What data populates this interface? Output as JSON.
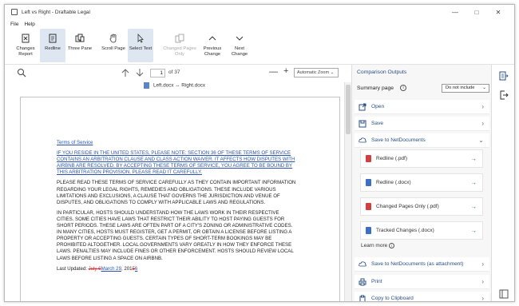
{
  "window": {
    "title": "Left vs Right - Draftable Legal",
    "controls": {
      "minimize": "—",
      "maximize": "□",
      "close": "✕"
    }
  },
  "menu": [
    "File",
    "Help"
  ],
  "ribbon": [
    {
      "label": "Changes Report",
      "icon": "changes-report-icon"
    },
    {
      "label": "Redline",
      "icon": "redline-icon",
      "active": true
    },
    {
      "label": "Three Pane",
      "icon": "three-pane-icon"
    },
    {
      "label": "Scroll Page",
      "icon": "scroll-page-icon"
    },
    {
      "label": "Select Text",
      "icon": "select-text-icon",
      "active": true
    },
    {
      "label": "Changed Pages Only",
      "icon": "changed-pages-icon",
      "disabled": true
    },
    {
      "label": "Previous Change",
      "icon": "chevron-up-icon"
    },
    {
      "label": "Next Change",
      "icon": "chevron-down-icon"
    }
  ],
  "toolbar": {
    "page_current": "1",
    "page_of": "of 37",
    "zoom": "Automatic Zoom",
    "zoom_minus": "—",
    "zoom_plus": "+"
  },
  "document": {
    "filename": "Left.docx ↔ Right.docx",
    "heading": "Terms of Service",
    "para1": "IF YOU RESIDE IN THE UNITED STATES, PLEASE NOTE: SECTION 36 OF THESE TERMS OF SERVICE CONTAINS AN ARBITRATION CLAUSE AND CLASS ACTION WAIVER. IT AFFECTS HOW DISPUTES WITH AIRBNB ARE RESOLVED. BY ACCEPTING THESE TERMS OF SERVICE, YOU AGREE TO BE BOUND BY THIS ARBITRATION PROVISION. PLEASE READ IT CAREFULLY.",
    "para2": "PLEASE READ THESE TERMS OF SERVICE CAREFULLY AS THEY CONTAIN IMPORTANT INFORMATION REGARDING YOUR LEGAL RIGHTS, REMEDIES AND OBLIGATIONS. THESE INCLUDE VARIOUS LIMITATIONS AND EXCLUSIONS, A CLAUSE THAT GOVERNS THE JURISDICTION AND VENUE OF DISPUTES, AND OBLIGATIONS TO COMPLY WITH APPLICABLE LAWS AND REGULATIONS.",
    "para3": "IN PARTICULAR, HOSTS SHOULD UNDERSTAND HOW THE LAWS WORK IN THEIR RESPECTIVE CITIES. SOME CITIES HAVE LAWS THAT RESTRICT THEIR ABILITY TO HOST PAYING GUESTS FOR SHORT PERIODS. THESE LAWS ARE OFTEN PART OF A CITY'S ZONING OR ADMINISTRATIVE CODES. IN MANY CITIES, HOSTS MUST REGISTER, GET A PERMIT, OR OBTAIN A LICENSE BEFORE LISTING A PROPERTY OR ACCEPTING GUESTS. CERTAIN TYPES OF SHORT-TERM BOOKINGS MAY BE PROHIBITED ALTOGETHER. LOCAL GOVERNMENTS VARY GREATLY IN HOW THEY ENFORCE THESE LAWS. PENALTIES MAY INCLUDE FINES OR OTHER ENFORCEMENT. HOSTS SHOULD REVIEW LOCAL LAWS BEFORE LISTING A SPACE ON AIRBNB.",
    "updated_label": "Last Updated: ",
    "updated_del1": "July 6",
    "updated_ins1": "March 29",
    "updated_mid": ", 201",
    "updated_del2": "5",
    "updated_ins2": "6"
  },
  "panel": {
    "title": "Comparison Outputs",
    "summary_label": "Summary page",
    "summary_select": "Do not include",
    "open": "Open",
    "save": "Save",
    "save_nd": "Save to NetDocuments",
    "sub_items": [
      "Redline (.pdf)",
      "Redline (.docx)",
      "Changed Pages Only (.pdf)",
      "Tracked Changes (.docx)"
    ],
    "learn_more": "Learn more",
    "save_nd_attach": "Save to NetDocuments (as attachment)",
    "print": "Print",
    "copy": "Copy to Clipboard"
  }
}
